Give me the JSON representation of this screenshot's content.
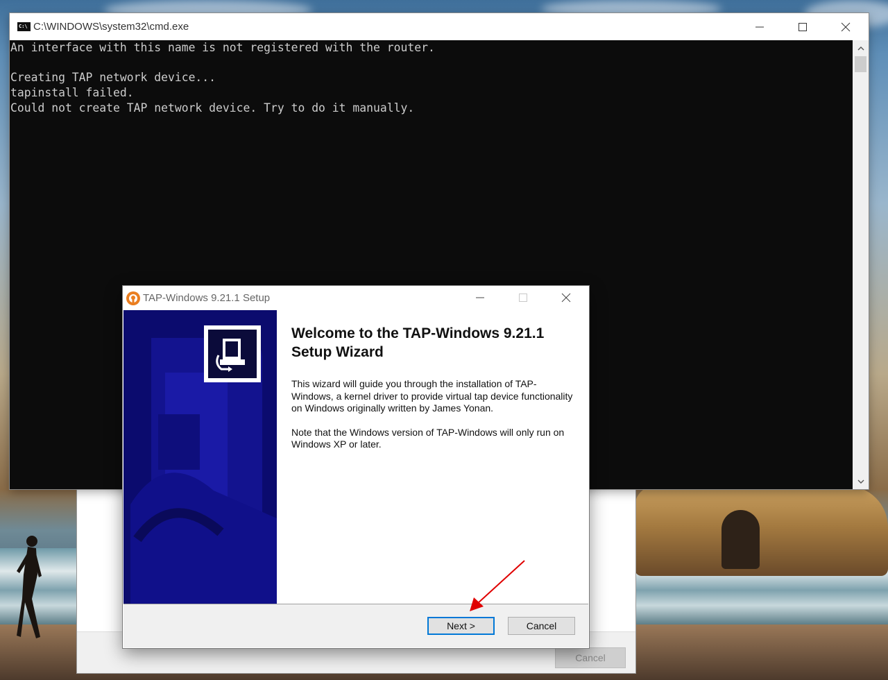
{
  "cmd": {
    "title": "C:\\WINDOWS\\system32\\cmd.exe",
    "icon_text": "C:\\",
    "lines": [
      "An interface with this name is not registered with the router.",
      "",
      "Creating TAP network device...",
      "tapinstall failed.",
      "Could not create TAP network device. Try to do it manually."
    ]
  },
  "background_dialog": {
    "cancel_label": "Cancel"
  },
  "setup": {
    "title": "TAP-Windows 9.21.1 Setup",
    "heading": "Welcome to the TAP-Windows 9.21.1 Setup Wizard",
    "paragraph1": "This wizard will guide you through the installation of TAP-Windows, a kernel driver to provide virtual tap device functionality on Windows originally written by James Yonan.",
    "paragraph2": "Note that the Windows version of TAP-Windows will only run on Windows XP or later.",
    "next_label": "Next >",
    "cancel_label": "Cancel"
  },
  "colors": {
    "sidebar": "#0b0b6e",
    "console_bg": "#0c0c0c",
    "console_text": "#cccccc",
    "annotation_arrow": "#e00000"
  }
}
